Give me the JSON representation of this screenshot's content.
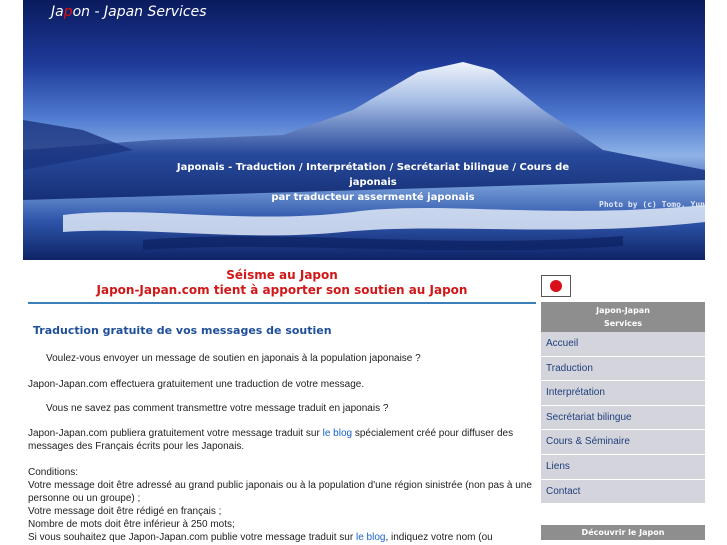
{
  "banner": {
    "brand_prefix": "Ja",
    "brand_red": "p",
    "brand_suffix": "on - Japan Services",
    "tagline_line1": "Japonais - Traduction / Interprétation / Secrétariat bilingue / Cours de japonais",
    "tagline_line2": "par traducteur assermenté japonais",
    "photo_credit": "Photo by (c) Tomo. Yun"
  },
  "main": {
    "quake_title": "Séisme au Japon",
    "quake_subtitle": "Japon-Japan.com tient à apporter son soutien au Japon",
    "section_title": "Traduction gratuite de vos messages de soutien",
    "p1": "Voulez-vous envoyer un message de soutien en japonais à la population japonaise ?",
    "p2": "Japon-Japan.com effectuera gratuitement une traduction de votre message.",
    "p3": "Vous ne savez pas comment transmettre votre message traduit en japonais ?",
    "p4_before": "Japon-Japan.com publiera gratuitement votre message traduit sur ",
    "p4_link": "le blog",
    "p4_after": " spécialement créé pour diffuser des messages des Français écrits pour les Japonais.",
    "conditions_label": "Conditions:",
    "cond1": "Votre message doit être adressé au grand public japonais ou à la population d'une région sinistrée (non pas à une personne ou un groupe) ;",
    "cond2": "Votre message doit être rédigé en français ;",
    "cond3": "Nombre de mots doit être inférieur à 250 mots;",
    "cond4_before": "Si vous souhaitez que Japon-Japan.com publie votre message traduit sur ",
    "cond4_link": "le blog",
    "cond4_after": ", indiquez votre nom (ou"
  },
  "sidebar": {
    "header_line1": "Japon-Japan",
    "header_line2": "Services",
    "items": [
      "Accueil",
      "Traduction",
      "Interprétation",
      "Secrétariat bilingue",
      "Cours & Séminaire",
      "Liens",
      "Contact"
    ],
    "discover_title": "Découvrir le Japon"
  },
  "colors": {
    "accent_red": "#d01818",
    "accent_blue": "#1f4f9a",
    "link": "#1a62c8",
    "nav_bg": "#d4d4dc",
    "nav_head": "#8e8e8e"
  }
}
